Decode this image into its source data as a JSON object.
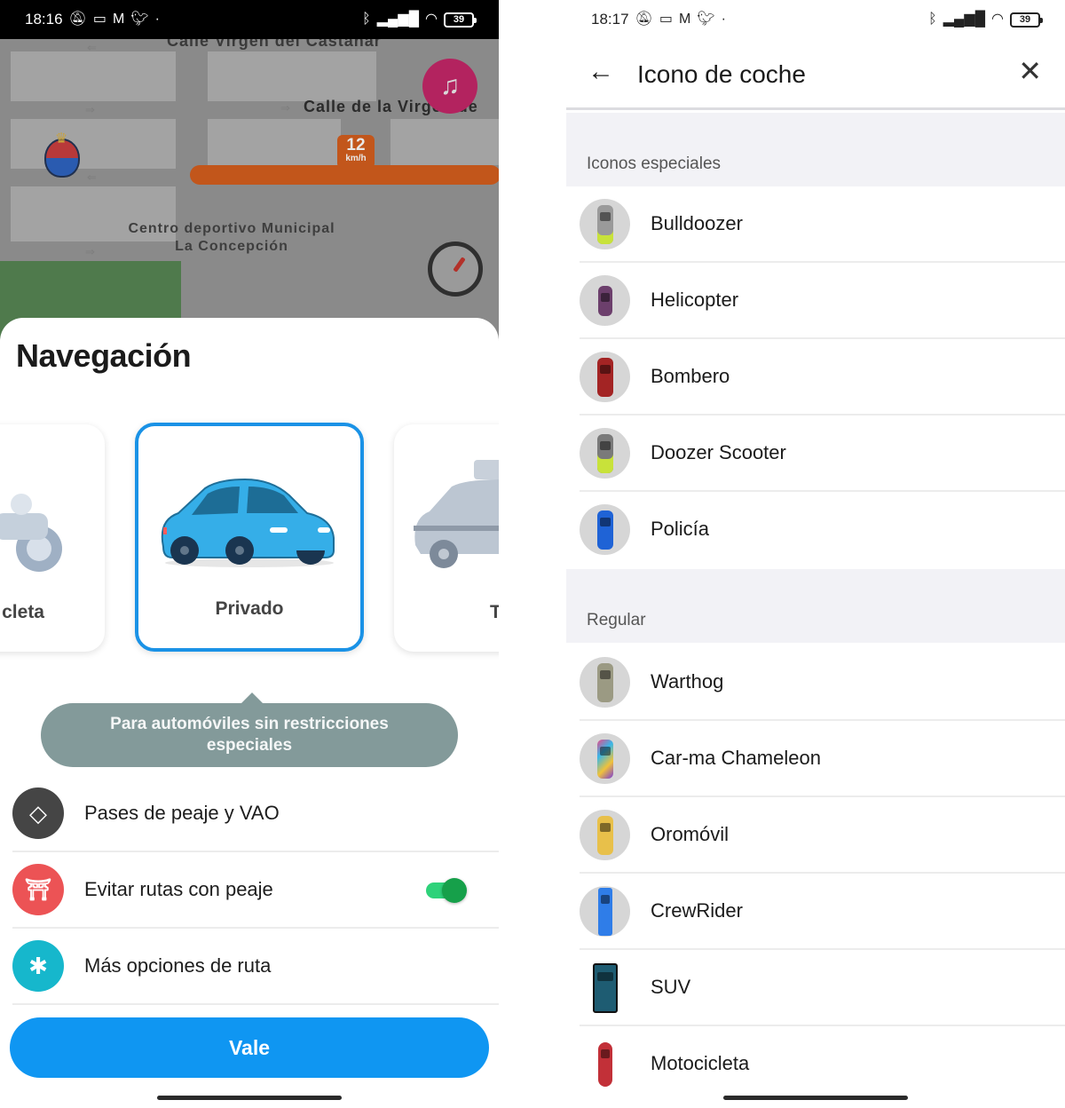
{
  "left_screen": {
    "status_bar": {
      "time": "18:16",
      "left_icons": [
        "mute-icon",
        "laptop-icon",
        "gmail-icon",
        "twitter-icon",
        "dot-icon"
      ],
      "right_icons": [
        "bluetooth-icon",
        "signal-icon",
        "wifi-icon"
      ],
      "battery": "39"
    },
    "map": {
      "street_top": "Calle Virgen del Castañar",
      "street_middle": "Calle de la Virgen de",
      "poi_line1": "Centro deportivo Municipal",
      "poi_line2": "La Concepción",
      "speed_value": "12",
      "speed_unit": "km/h",
      "music_button_icon": "music-note-icon",
      "speedometer_icon": "speedometer-icon"
    },
    "sheet": {
      "title": "Navegación",
      "modes": [
        {
          "label": "Motocicleta",
          "visible_label": "cleta",
          "selected": false
        },
        {
          "label": "Privado",
          "visible_label": "Privado",
          "selected": true
        },
        {
          "label": "Taxi",
          "visible_label": "T",
          "selected": false
        }
      ],
      "tooltip": "Para automóviles sin restricciones especiales",
      "options": [
        {
          "label": "Pases de peaje y VAO",
          "icon": "toll-pass-diamond-icon",
          "color": "#454545"
        },
        {
          "label": "Evitar rutas con peaje",
          "icon": "toll-booth-icon",
          "color": "#ec5355",
          "toggle": true
        },
        {
          "label": "Más opciones de ruta",
          "icon": "route-options-icon",
          "color": "#16b7cc"
        }
      ],
      "confirm_button": "Vale"
    },
    "colors": {
      "accent_blue": "#0f96f2",
      "selected_border": "#1a92e6",
      "toggle_on": "#16a04a",
      "tooltip_bg": "#839a9a"
    }
  },
  "right_screen": {
    "status_bar": {
      "time": "18:17",
      "left_icons": [
        "mute-icon",
        "laptop-icon",
        "gmail-icon",
        "twitter-icon",
        "dot-icon"
      ],
      "right_icons": [
        "bluetooth-icon",
        "signal-icon",
        "wifi-icon"
      ],
      "battery": "39"
    },
    "app_bar": {
      "title": "Icono de coche",
      "back_icon": "arrow-left-icon",
      "close_icon": "close-icon"
    },
    "sections": [
      {
        "header": "Iconos especiales",
        "items": [
          {
            "name": "Bulldoozer",
            "color": "#9a9a9a"
          },
          {
            "name": "Helicopter",
            "color": "#c25fd6"
          },
          {
            "name": "Bombero",
            "color": "#a32424"
          },
          {
            "name": "Doozer Scooter",
            "color": "#7e8a2f"
          },
          {
            "name": "Policía",
            "color": "#1f63d6"
          }
        ]
      },
      {
        "header": "Regular",
        "items": [
          {
            "name": "Warthog",
            "color": "#9b9a83"
          },
          {
            "name": "Car-ma Chameleon",
            "color": "#d94d9a"
          },
          {
            "name": "Oromóvil",
            "color": "#e8c04a"
          },
          {
            "name": "CrewRider",
            "color": "#2f7de8"
          },
          {
            "name": "SUV",
            "color": "#1e5c72"
          },
          {
            "name": "Motocicleta",
            "color": "#c23038"
          }
        ]
      }
    ]
  }
}
